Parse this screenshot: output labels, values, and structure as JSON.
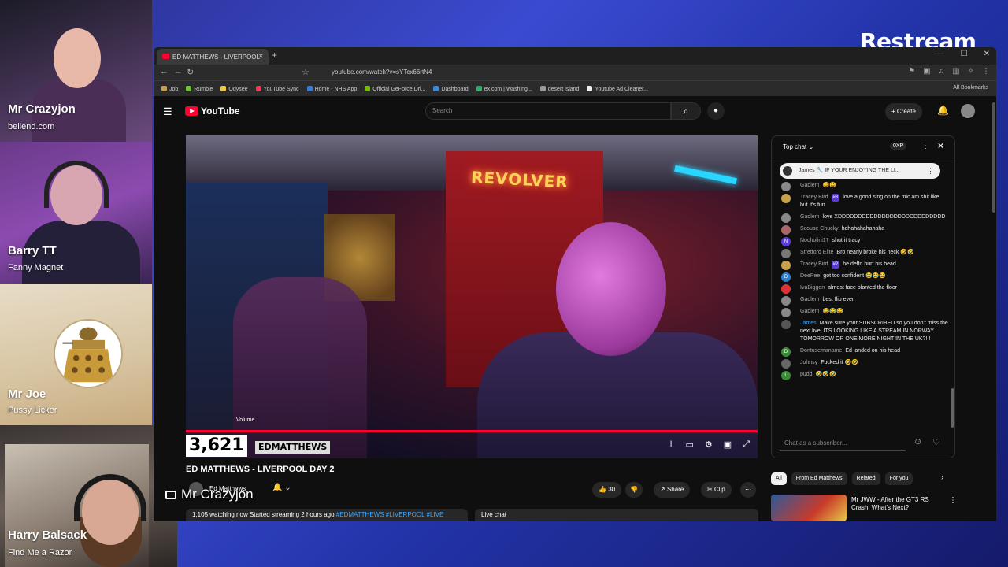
{
  "app": {
    "brand": "Restream"
  },
  "participants": [
    {
      "name": "Mr Crazyjon",
      "subtitle": "bellend.com"
    },
    {
      "name": "Barry TT",
      "subtitle": "Fanny Magnet"
    },
    {
      "name": "Mr Joe",
      "subtitle": "Pussy Licker"
    },
    {
      "name": "Harry Balsack",
      "subtitle": "Find Me a Razor"
    }
  ],
  "screen_share": {
    "label": "Mr Crazyjon",
    "icon": "monitor-icon"
  },
  "browser": {
    "tab_title": "ED MATTHEWS - LIVERPOOL",
    "url": "youtube.com/watch?v=sYTcx66rtN4",
    "bookmarks": [
      "Job",
      "Rumble",
      "Odysee",
      "YouTube Sync",
      "Home - NHS App",
      "Official GeForce Dri...",
      "Dashboard",
      "ex.com | Washing...",
      "desert island",
      "Youtube Ad Cleaner..."
    ],
    "all_bookmarks": "All Bookmarks"
  },
  "youtube": {
    "logo": "YouTube",
    "search_placeholder": "Search",
    "create": "+ Create",
    "video": {
      "title": "ED MATTHEWS - LIVERPOOL DAY 2",
      "overlay_number": "3,621",
      "overlay_name": "EDMATTHEWS",
      "sign_text": "REVOLVER",
      "volume_label": "Volume",
      "progress": 1.0,
      "channel": "Ed Matthews",
      "likes": "30",
      "share": "Share",
      "clip": "Clip",
      "views": "1,105 watching now  Started streaming 2 hours ago",
      "tags": "#EDMATTHEWS #LIVERPOOL #LIVE",
      "live_chat_label": "Live chat"
    },
    "chat": {
      "mode": "Top chat",
      "xp": "0XP",
      "pinned": {
        "author": "James",
        "text": "IF YOUR ENJOYING THE LI..."
      },
      "messages": [
        {
          "author": "Gadlem",
          "text": "😄😄",
          "avatar_color": "#888"
        },
        {
          "author": "Tracey Bird",
          "badge": "#3",
          "text": "love a good sing on the mic am shit like but it's fun",
          "avatar_color": "#c9a04a"
        },
        {
          "author": "Gadlem",
          "text": "love XDDDDDDDDDDDDDDDDDDDDDDDDDDD",
          "avatar_color": "#888"
        },
        {
          "author": "Scouse Chucky",
          "text": "hahahahahahaha",
          "avatar_color": "#a66"
        },
        {
          "author": "Nocholini17",
          "text": "shut it tracy",
          "avatar_initial": "N",
          "avatar_color": "#5b3bd6"
        },
        {
          "author": "Stretford Elite",
          "text": "Bro nearly broke his neck 🤣🤣",
          "avatar_color": "#777"
        },
        {
          "author": "Tracey Bird",
          "badge": "#2",
          "text": "he deffo hurt his head",
          "avatar_color": "#c9a04a"
        },
        {
          "author": "DeePee",
          "text": "got too confident 😂😂😂",
          "avatar_initial": "D",
          "avatar_color": "#2b7fd1"
        },
        {
          "author": "IvaBiggen",
          "text": "almost face planted the floor",
          "avatar_color": "#d33"
        },
        {
          "author": "Gadlem",
          "text": "best flip ever",
          "avatar_color": "#888"
        },
        {
          "author": "Gadlem",
          "text": "😂😂😂",
          "avatar_color": "#888"
        },
        {
          "author": "James",
          "owner": true,
          "text": "Make sure your SUBSCRIBED so you don't miss the next live. ITS LOOKING LIKE A STREAM IN NORWAY TOMORROW OR ONE MORE NIGHT IN THE UK?!!!",
          "avatar_color": "#555"
        },
        {
          "author": "Dontusemaname",
          "text": "Ed landed on his head",
          "avatar_initial": "D",
          "avatar_color": "#3a8a3a"
        },
        {
          "author": "Johnsy",
          "text": "Fucked it 🤣🤣",
          "avatar_color": "#666"
        },
        {
          "author": "pudd",
          "text": "🤣🤣🤣",
          "avatar_initial": "L",
          "avatar_color": "#3a8a3a"
        }
      ],
      "input_placeholder": "Chat as a subscriber..."
    },
    "chips": [
      "All",
      "From Ed Matthews",
      "Related",
      "For you"
    ],
    "related": {
      "title": "Mr JWW - After the GT3 RS Crash: What's Next?"
    }
  }
}
